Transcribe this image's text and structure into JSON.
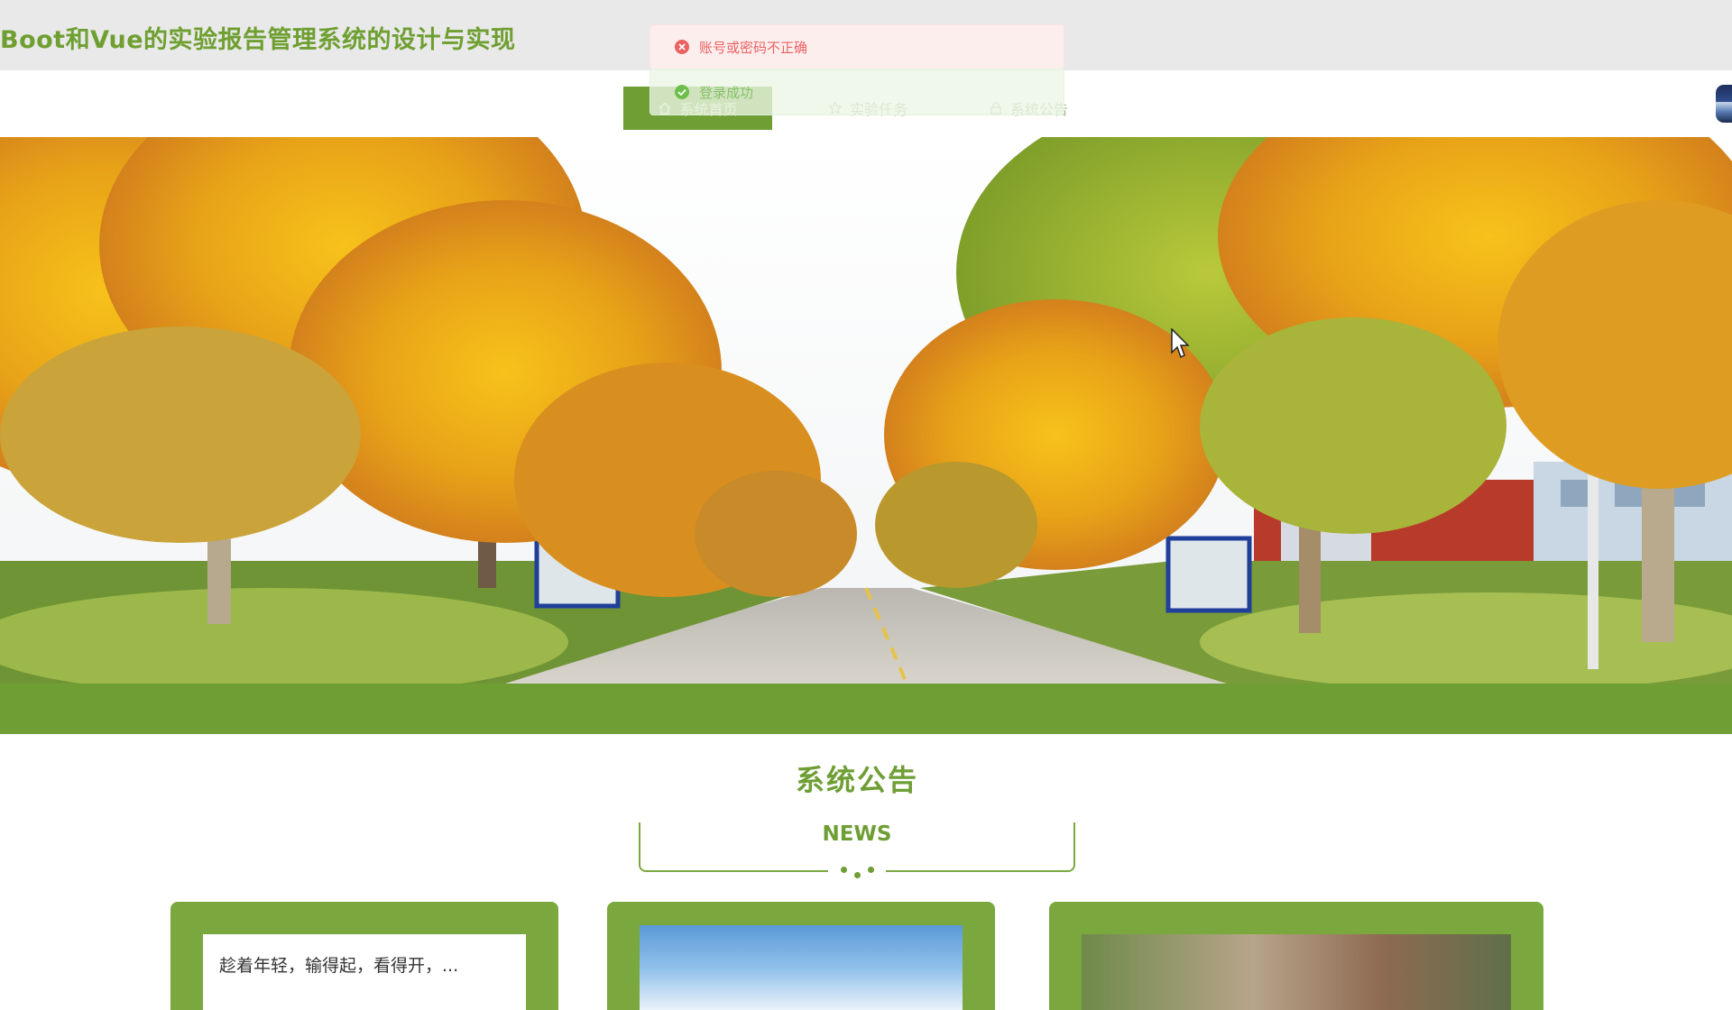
{
  "header": {
    "title": "Boot和Vue的实验报告管理系统的设计与实现"
  },
  "nav": {
    "items": [
      {
        "label": "系统首页",
        "icon": "home-icon",
        "active": true
      },
      {
        "label": "实验任务",
        "icon": "star-icon",
        "active": false
      },
      {
        "label": "系统公告",
        "icon": "lock-icon",
        "active": false
      }
    ]
  },
  "toasts": {
    "error": {
      "text": "账号或密码不正确",
      "icon": "error-circle-icon",
      "color": "#ec6262"
    },
    "success": {
      "text": "登录成功",
      "icon": "success-circle-icon",
      "color": "#86c26a"
    }
  },
  "notice": {
    "title": "系统公告",
    "subtitle": "NEWS",
    "cards": [
      {
        "text": "趁着年轻，输得起，看得开，..."
      },
      {
        "text": ""
      },
      {
        "text": ""
      }
    ]
  },
  "colors": {
    "primary_green": "#6e9e34",
    "title_green": "#6f9f31",
    "header_bg": "#e9e9e9"
  }
}
